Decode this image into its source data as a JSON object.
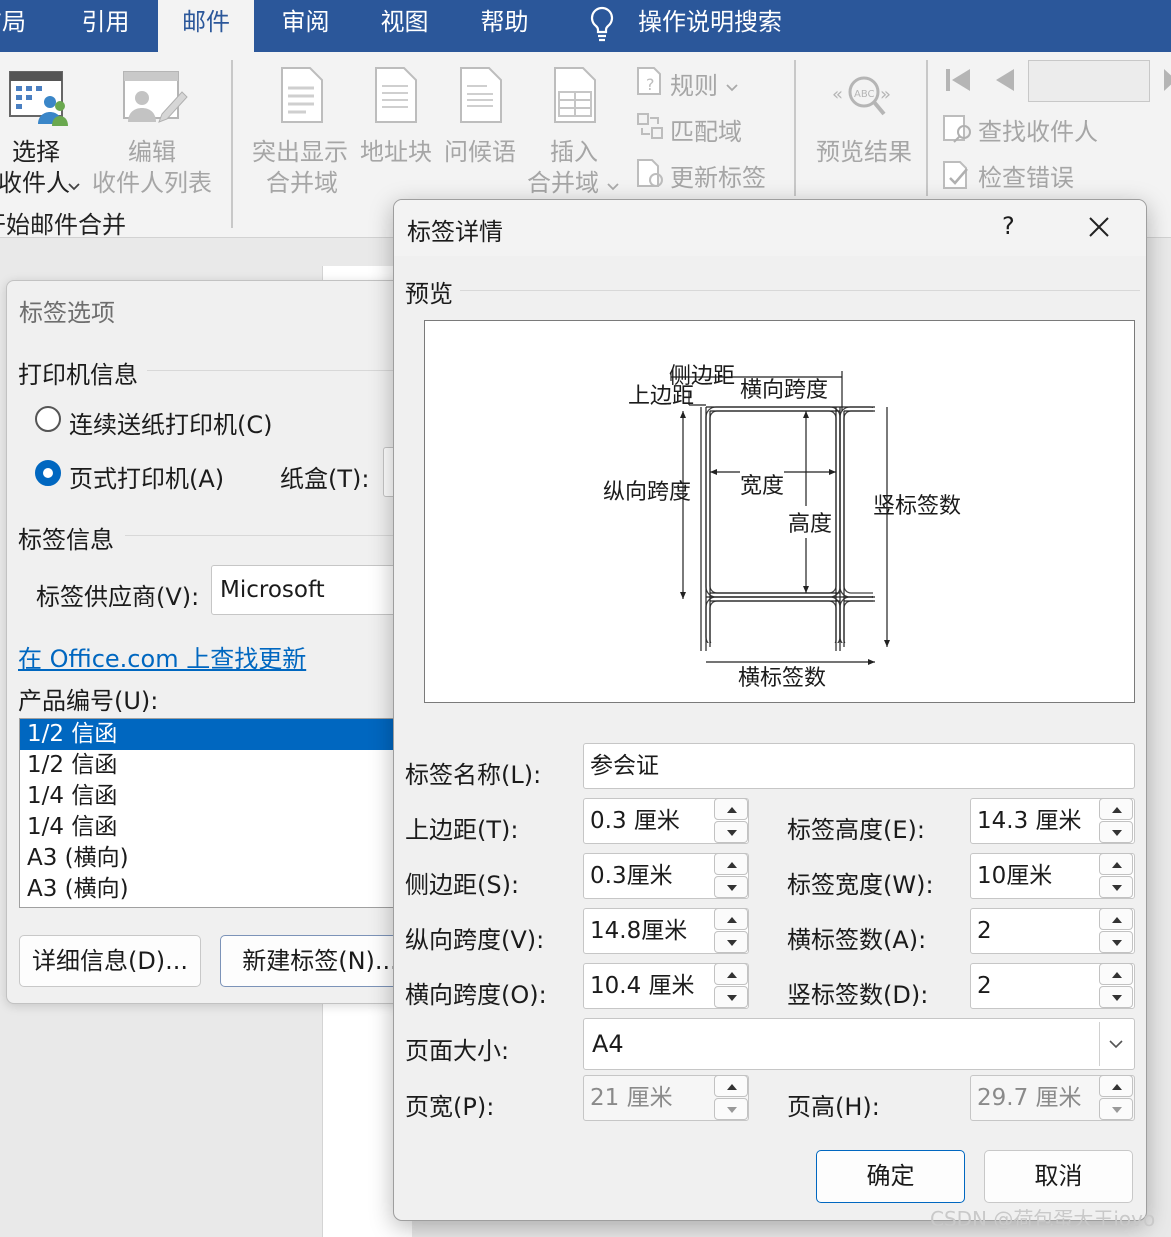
{
  "ribbon": {
    "tabs": [
      {
        "label": "布局",
        "active": false
      },
      {
        "label": "引用",
        "active": false
      },
      {
        "label": "邮件",
        "active": true
      },
      {
        "label": "审阅",
        "active": false
      },
      {
        "label": "视图",
        "active": false
      },
      {
        "label": "帮助",
        "active": false
      }
    ],
    "tell_me": "操作说明搜索",
    "select_recipients": [
      "选择",
      "收件人"
    ],
    "edit_recipients": [
      "编辑",
      "收件人列表"
    ],
    "start_group": "开始邮件合并",
    "highlight_merge": [
      "突出显示",
      "合并域"
    ],
    "address_block": "地址块",
    "greeting": "问候语",
    "insert_merge": [
      "插入",
      "合并域"
    ],
    "rules": "规则",
    "match_fields": "匹配域",
    "update_labels": "更新标签",
    "preview_results": "预览结果",
    "find_recipient": "查找收件人",
    "check_errors": "检查错误"
  },
  "label_options": {
    "title": "标签选项",
    "printer_info": "打印机信息",
    "continuous": "连续送纸打印机(C)",
    "page_printer": "页式打印机(A)",
    "tray_label": "纸盒(T):",
    "label_info": "标签信息",
    "vendor_label": "标签供应商(V):",
    "vendor_value": "Microsoft",
    "office_link": "在 Office.com 上查找更新",
    "product_label": "产品编号(U):",
    "products": [
      "1/2 信函",
      "1/2 信函",
      "1/4 信函",
      "1/4 信函",
      "A3 (横向)",
      "A3 (横向)"
    ],
    "details_button": "详细信息(D)...",
    "new_label_button": "新建标签(N)..."
  },
  "label_details": {
    "title": "标签详情",
    "help": "?",
    "preview_label": "预览",
    "diagram": {
      "side_margin": "侧边距",
      "top_margin": "上边距",
      "horizontal_pitch": "横向跨度",
      "vertical_pitch": "纵向跨度",
      "width": "宽度",
      "height": "高度",
      "number_down": "竖标签数",
      "number_across": "横标签数"
    },
    "name_label": "标签名称(L):",
    "name_value": "参会证",
    "top_margin_label": "上边距(T):",
    "top_margin_value": "0.3 厘米",
    "side_margin_label": "侧边距(S):",
    "side_margin_value": "0.3厘米",
    "vertical_pitch_label": "纵向跨度(V):",
    "vertical_pitch_value": "14.8厘米",
    "horizontal_pitch_label": "横向跨度(O):",
    "horizontal_pitch_value": "10.4 厘米",
    "label_height_label": "标签高度(E):",
    "label_height_value": "14.3 厘米",
    "label_width_label": "标签宽度(W):",
    "label_width_value": "10厘米",
    "number_across_label": "横标签数(A):",
    "number_across_value": "2",
    "number_down_label": "竖标签数(D):",
    "number_down_value": "2",
    "page_size_label": "页面大小:",
    "page_size_value": "A4",
    "page_width_label": "页宽(P):",
    "page_width_value": "21 厘米",
    "page_height_label": "页高(H):",
    "page_height_value": "29.7 厘米",
    "ok": "确定",
    "cancel": "取消"
  },
  "watermark": "CSDN @荷包蛋大王iovo",
  "colors": {
    "accent": "#2b579a",
    "selection": "#0067c0",
    "link": "#0067c0"
  }
}
